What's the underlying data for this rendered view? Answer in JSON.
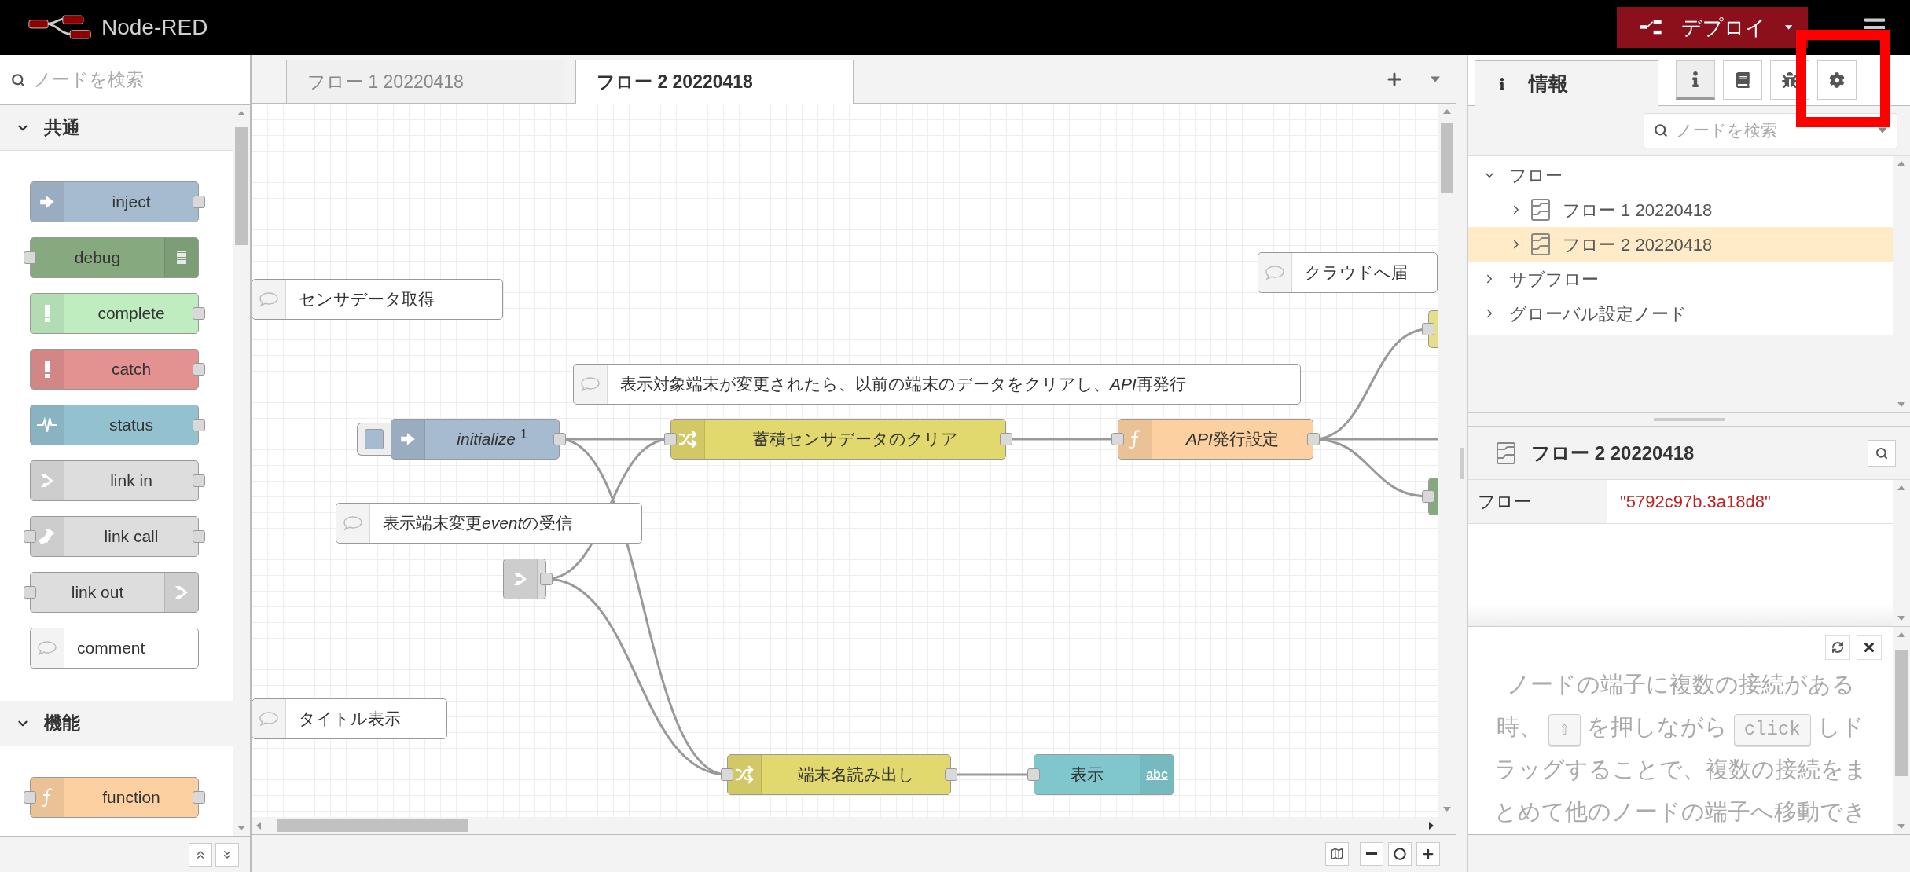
{
  "header": {
    "title": "Node-RED",
    "deploy": {
      "label": "デプロイ"
    }
  },
  "palette": {
    "search": {
      "placeholder": "ノードを検索"
    },
    "categories": [
      {
        "name": "共通",
        "expanded": true,
        "nodes": [
          {
            "kind": "inject",
            "label": "inject"
          },
          {
            "kind": "debug",
            "label": "debug"
          },
          {
            "kind": "complete",
            "label": "complete"
          },
          {
            "kind": "catch",
            "label": "catch"
          },
          {
            "kind": "status",
            "label": "status"
          },
          {
            "kind": "link-in",
            "label": "link in"
          },
          {
            "kind": "link-call",
            "label": "link call"
          },
          {
            "kind": "link-out",
            "label": "link out"
          },
          {
            "kind": "comment",
            "label": "comment"
          }
        ]
      },
      {
        "name": "機能",
        "expanded": true,
        "nodes": [
          {
            "kind": "function",
            "label": "function"
          }
        ]
      }
    ]
  },
  "workspace": {
    "tabs": [
      {
        "label": "フロー 1 20220418",
        "selected": false
      },
      {
        "label": "フロー 2 20220418",
        "selected": true
      }
    ],
    "nodes": [
      {
        "kind": "comment",
        "label": "センサデータ取得"
      },
      {
        "kind": "comment",
        "label": [
          {
            "text": "表示対象端末が変更されたら、以前の端末のデータをクリアし、",
            "italic": false
          },
          {
            "text": "API",
            "italic": true
          },
          {
            "text": "再発行",
            "italic": false
          }
        ]
      },
      {
        "kind": "comment",
        "label": "クラウドへ届"
      },
      {
        "kind": "inject",
        "label": "*initialize* $^{1}$"
      },
      {
        "kind": "change",
        "label": "蓄積センサデータのクリア"
      },
      {
        "kind": "function",
        "label": [
          {
            "text": "API",
            "italic": true
          },
          {
            "text": "発行設定",
            "italic": false
          }
        ]
      },
      {
        "kind": "comment",
        "label": [
          {
            "text": "表示端末変更",
            "italic": false
          },
          {
            "text": "event",
            "italic": true
          },
          {
            "text": "の受信",
            "italic": false
          }
        ]
      },
      {
        "kind": "link-in"
      },
      {
        "kind": "comment",
        "label": "タイトル表示"
      },
      {
        "kind": "change",
        "label": "端末名読み出し"
      },
      {
        "kind": "ui-text",
        "label": "表示",
        "icon_text": "abc"
      },
      {
        "kind": "stub",
        "color": "#e6df8a"
      },
      {
        "kind": "stub",
        "color": "#87a980"
      }
    ]
  },
  "sidebar": {
    "tab": {
      "label": "情報",
      "selected": true
    },
    "tab_buttons": [
      {
        "kind": "info",
        "selected": true
      },
      {
        "kind": "help",
        "selected": false
      },
      {
        "kind": "debug",
        "selected": false
      },
      {
        "kind": "config",
        "selected": false
      }
    ],
    "search": {
      "placeholder": "ノードを検索"
    },
    "tree": [
      {
        "label": "フロー",
        "expanded": true,
        "selected": false,
        "children": [
          {
            "label": "フロー 1 20220418",
            "expanded": false,
            "selected": false
          },
          {
            "label": "フロー 2 20220418",
            "expanded": false,
            "selected": true
          }
        ]
      },
      {
        "label": "サブフロー",
        "expanded": false,
        "selected": false
      },
      {
        "label": "グローバル設定ノード",
        "expanded": false,
        "selected": false
      }
    ],
    "info": {
      "title": "フロー 2 20220418",
      "rows": [
        {
          "key": "フロー",
          "value": "\"5792c97b.3a18d8\""
        }
      ]
    },
    "tip": {
      "segments": [
        {
          "kind": "text",
          "text": "ノードの端子に複数の接続がある時、"
        },
        {
          "kind": "key",
          "text": "⇧"
        },
        {
          "kind": "text",
          "text": "を押しながら"
        },
        {
          "kind": "key",
          "text": "click"
        },
        {
          "kind": "text",
          "text": "しドラッグすることで、複数の接続をまとめて他のノードの端子へ移動でき"
        }
      ]
    }
  }
}
